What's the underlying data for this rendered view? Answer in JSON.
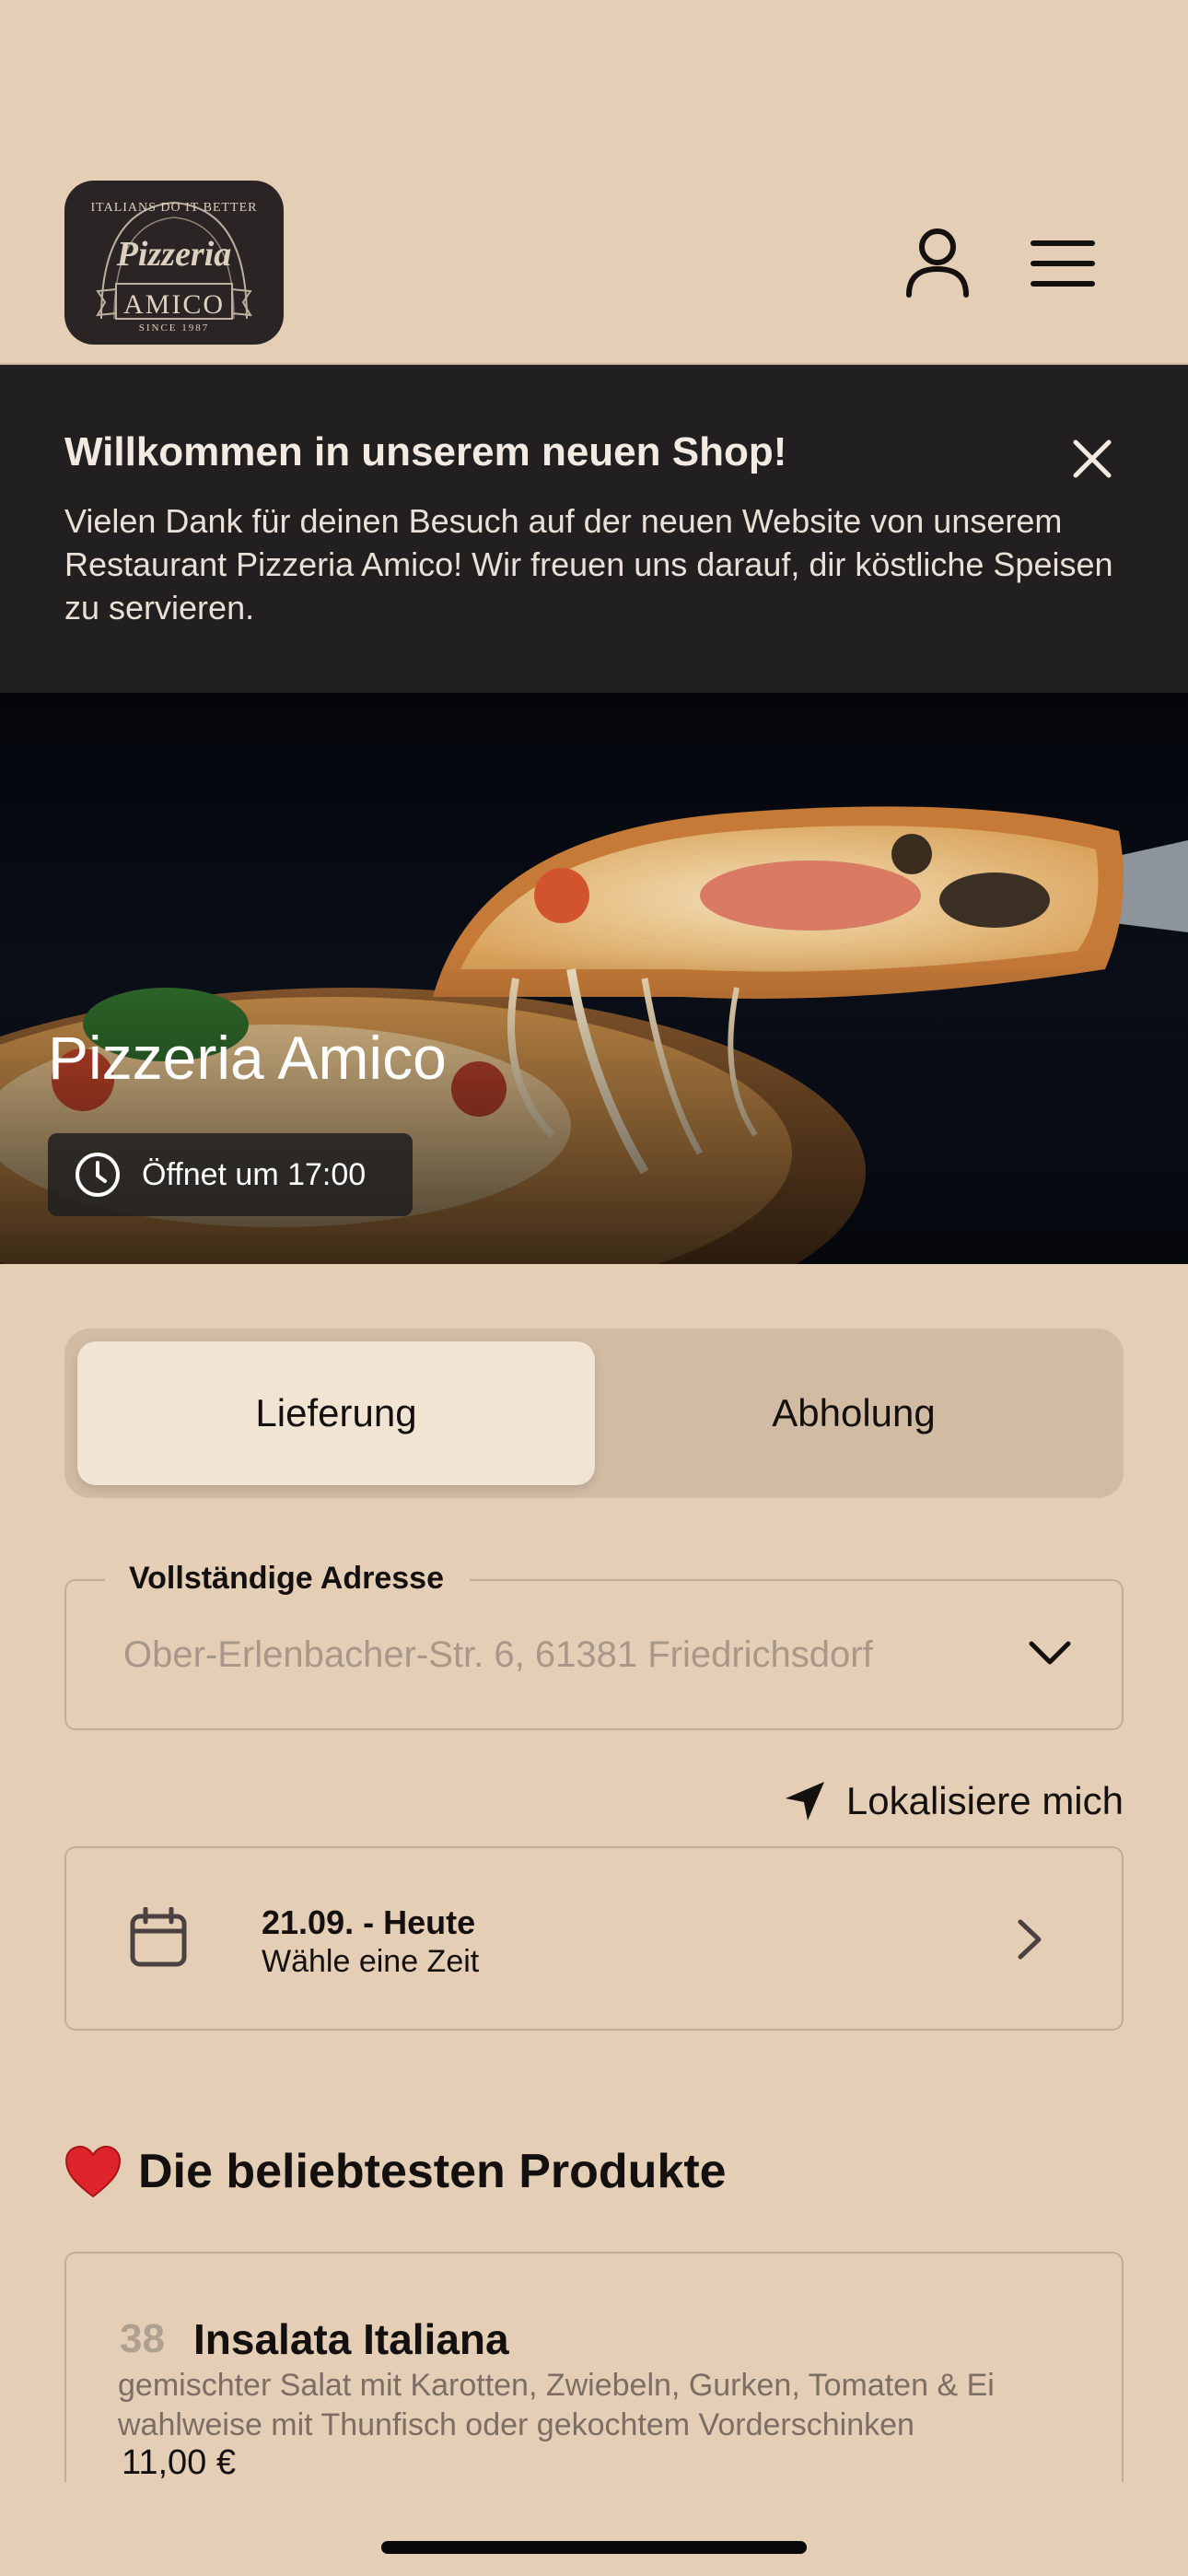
{
  "header": {
    "logo": {
      "top_text": "ITALIANS DO IT BETTER",
      "script_text": "Pizzeria",
      "name": "AMICO",
      "since": "SINCE 1987"
    },
    "icons": {
      "account": "user-icon",
      "menu": "hamburger-menu-icon"
    }
  },
  "banner": {
    "title": "Willkommen in unserem neuen Shop!",
    "text": "Vielen Dank für deinen Besuch auf der neuen Website von unserem Restaurant Pizzeria Amico! Wir freuen uns darauf, dir köstliche Speisen zu servieren.",
    "close_icon": "close-icon"
  },
  "hero": {
    "title": "Pizzeria Amico",
    "status": "Öffnet um 17:00",
    "status_icon": "clock-icon"
  },
  "order_mode": {
    "options": [
      "Lieferung",
      "Abholung"
    ],
    "selected": "Lieferung"
  },
  "address": {
    "label": "Vollständige Adresse",
    "placeholder": "Ober-Erlenbacher-Str. 6, 61381 Friedrichsdorf",
    "value": ""
  },
  "locate": {
    "label": "Lokalisiere mich",
    "icon": "location-arrow-icon"
  },
  "date": {
    "title": "21.09. - Heute",
    "subtitle": "Wähle eine Zeit",
    "icon": "calendar-icon"
  },
  "products_section": {
    "title": "Die beliebtesten Produkte",
    "icon": "heart-icon",
    "items": [
      {
        "number": "38",
        "name": "Insalata Italiana",
        "description": "gemischter Salat mit Karotten, Zwiebeln, Gurken, Tomaten & Ei wahlweise mit Thunfisch oder gekochtem Vorderschinken",
        "price": "11,00 €"
      }
    ]
  },
  "colors": {
    "background": "#e4cfb6",
    "banner": "#221f20",
    "toggle_track": "#d1bca3",
    "toggle_active": "#f1e4d3",
    "text": "#141010",
    "muted_text": "#7c6e64"
  }
}
